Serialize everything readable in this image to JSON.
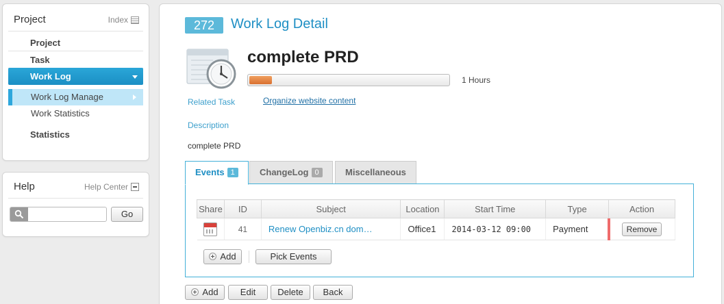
{
  "sidebar": {
    "project_panel": {
      "title": "Project",
      "link": "Index",
      "items": [
        {
          "label": "Project"
        },
        {
          "label": "Task"
        },
        {
          "label": "Work Log"
        },
        {
          "label": "Work Log Manage"
        },
        {
          "label": "Work Statistics"
        },
        {
          "label": "Statistics"
        }
      ]
    },
    "help_panel": {
      "title": "Help",
      "link": "Help Center",
      "search_placeholder": "",
      "go_label": "Go"
    }
  },
  "record": {
    "id": "272",
    "page_title": "Work Log Detail",
    "name": "complete PRD",
    "progress_fraction": 0.12,
    "hours": "1 Hours",
    "related_task_label": "Related Task",
    "related_task_value": "Organize website content",
    "description_label": "Description",
    "description_value": "complete PRD"
  },
  "tabs": [
    {
      "label": "Events",
      "count": "1",
      "active": true
    },
    {
      "label": "ChangeLog",
      "count": "0",
      "active": false
    },
    {
      "label": "Miscellaneous",
      "count": "",
      "active": false
    }
  ],
  "events_table": {
    "columns": [
      "Share",
      "ID",
      "Subject",
      "Location",
      "Start Time",
      "Type",
      "Action"
    ],
    "rows": [
      {
        "share_icon": "calendar-icon",
        "id": "41",
        "subject": "Renew Openbiz.cn dom…",
        "location": "Office1",
        "start_time": "2014-03-12 09:00",
        "type": "Payment",
        "action": "Remove"
      }
    ],
    "add_label": "Add",
    "pick_label": "Pick Events"
  },
  "footer_buttons": {
    "add": "Add",
    "edit": "Edit",
    "delete": "Delete",
    "back": "Back"
  },
  "colors": {
    "accent": "#1f8fc4",
    "active_menu": "#2aa6d8",
    "progress": "#e07a3a",
    "flag": "#ef6b6b"
  }
}
